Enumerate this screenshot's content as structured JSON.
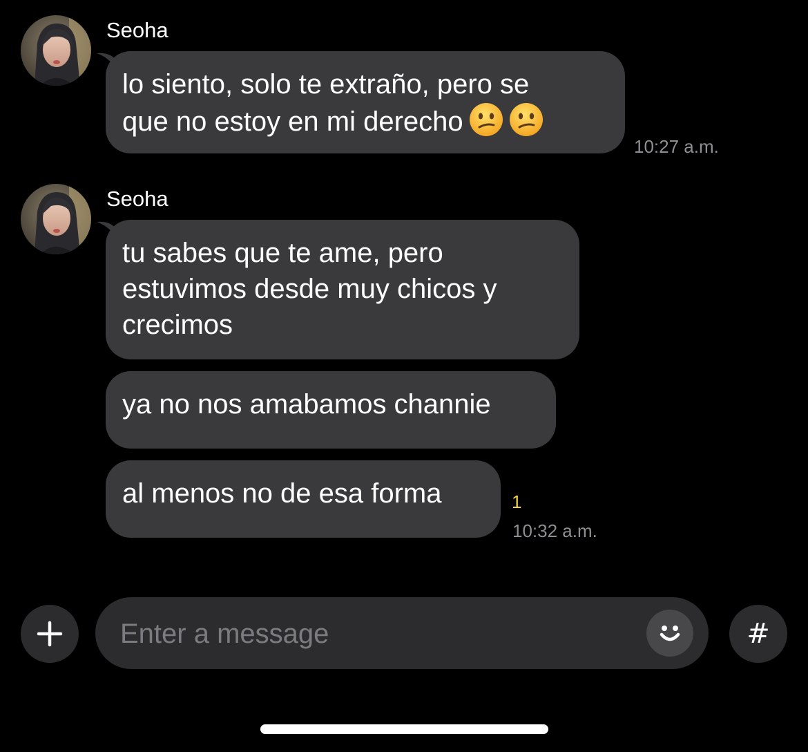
{
  "chat": {
    "messages": [
      {
        "sender": "Seoha",
        "text": "lo siento, solo te extraño, pero se\nque no estoy en mi derecho",
        "emojis": [
          "confused-face",
          "confused-face"
        ],
        "time": "10:27 a.m."
      },
      {
        "sender": "Seoha",
        "text": "tu sabes que te ame, pero\nestuvimos desde muy chicos y\ncrecimos"
      },
      {
        "text": "ya no nos amabamos channie"
      },
      {
        "text": "al menos no de esa forma",
        "unread_count": "1",
        "time": "10:32 a.m."
      }
    ]
  },
  "composer": {
    "placeholder": "Enter a message",
    "add_icon": "plus-icon",
    "emoji_icon": "smiley-icon",
    "hashtag_icon": "#"
  },
  "colors": {
    "background": "#000000",
    "bubble": "#3a3a3c",
    "timestamp": "#8e8e93",
    "unread": "#f5d53b",
    "input": "#2c2c2e"
  }
}
